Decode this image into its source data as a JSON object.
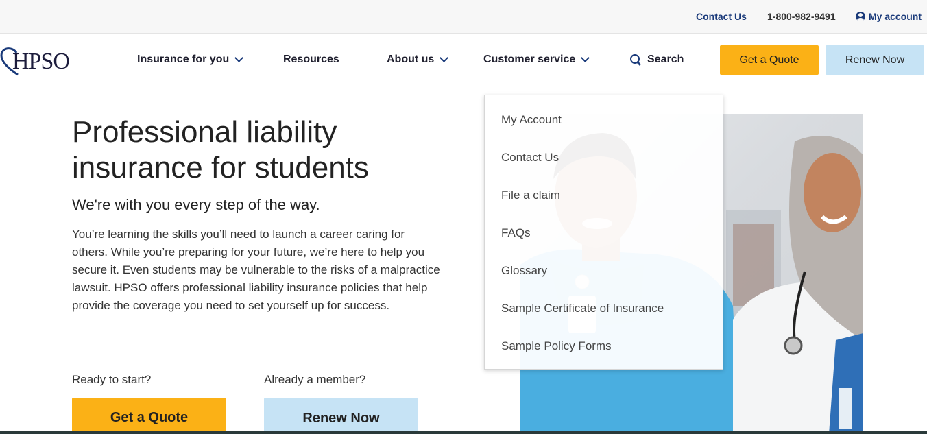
{
  "utility": {
    "contact": "Contact Us",
    "phone": "1-800-982-9491",
    "account": "My account"
  },
  "nav": {
    "logo_text": "HPSO",
    "items": [
      {
        "label": "Insurance for you"
      },
      {
        "label": "Resources"
      },
      {
        "label": "About us"
      },
      {
        "label": "Customer service"
      }
    ],
    "search": "Search",
    "quote_button": "Get a Quote",
    "renew_button": "Renew Now"
  },
  "hero": {
    "title_line1": "Professional liability",
    "title_line2": "insurance for students",
    "subtitle": "We're with you every step of the way.",
    "body": "You’re learning the skills you’ll need to launch a career caring for others. While you’re preparing for your future, we’re here to help you secure it. Even students may be vulnerable to the risks of a malpractice lawsuit. HPSO offers professional liability insurance policies that help provide the coverage you need to set yourself up for success.",
    "start_label": "Ready to start?",
    "member_label": "Already a member?",
    "quote_button": "Get a Quote",
    "renew_button": "Renew Now"
  },
  "dropdown": {
    "items": [
      {
        "label": "My Account"
      },
      {
        "label": "Contact Us"
      },
      {
        "label": "File a claim"
      },
      {
        "label": "FAQs"
      },
      {
        "label": "Glossary"
      },
      {
        "label": "Sample Certificate of Insurance"
      },
      {
        "label": "Sample Policy Forms"
      }
    ]
  },
  "colors": {
    "brand_navy": "#1a3a7a",
    "quote_yellow": "#fbb116",
    "renew_blue": "#c6e3f5"
  }
}
